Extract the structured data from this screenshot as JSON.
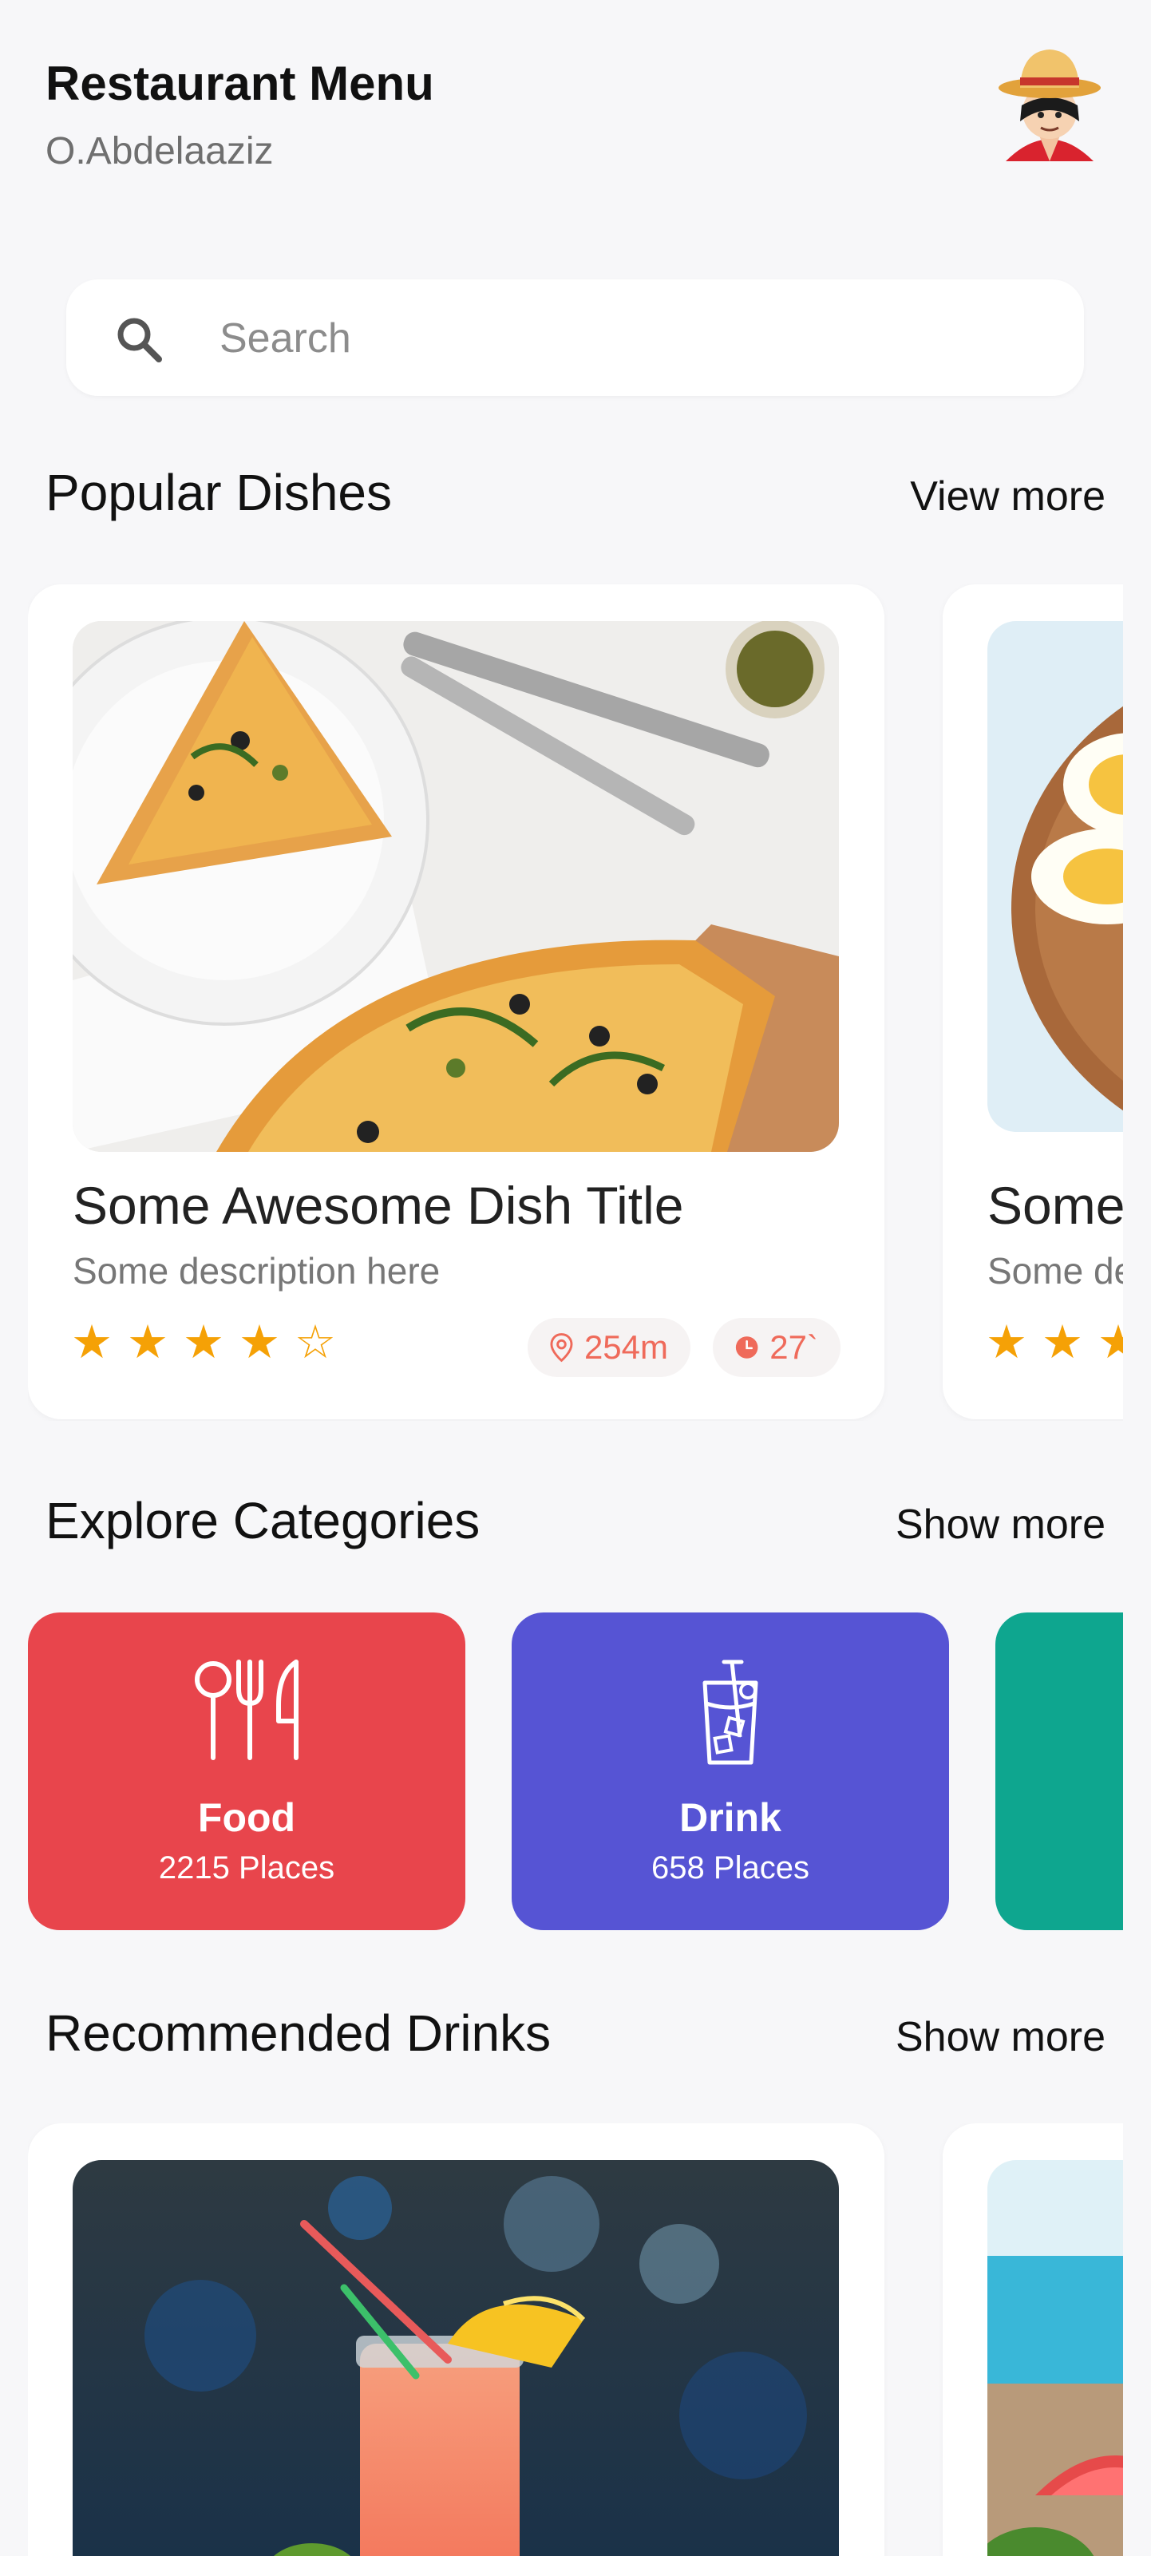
{
  "header": {
    "title": "Restaurant Menu",
    "subtitle": "O.Abdelaaziz"
  },
  "search": {
    "placeholder": "Search"
  },
  "popular": {
    "title": "Popular Dishes",
    "link": "View more",
    "dishes": [
      {
        "title": "Some Awesome Dish Title",
        "description": "Some description here",
        "rating": 4,
        "stars": "★★★★☆",
        "distance": "254m",
        "time": "27`"
      },
      {
        "title": "Some Awesome Dish Title",
        "description": "Some description here",
        "stars": "★★★"
      }
    ]
  },
  "categories": {
    "title": "Explore Categories",
    "link": "Show more",
    "items": [
      {
        "name": "Food",
        "count": "2215 Places",
        "color": "#e8454c",
        "icon": "fork-knife-icon"
      },
      {
        "name": "Drink",
        "count": "658 Places",
        "color": "#5654d4",
        "icon": "drink-glass-icon"
      },
      {
        "color": "#0ea68f"
      }
    ]
  },
  "drinks": {
    "title": "Recommended Drinks",
    "link": "Show more"
  },
  "colors": {
    "star": "#f5a106",
    "pill_text": "#ef6a5a",
    "background": "#f7f7f9"
  }
}
